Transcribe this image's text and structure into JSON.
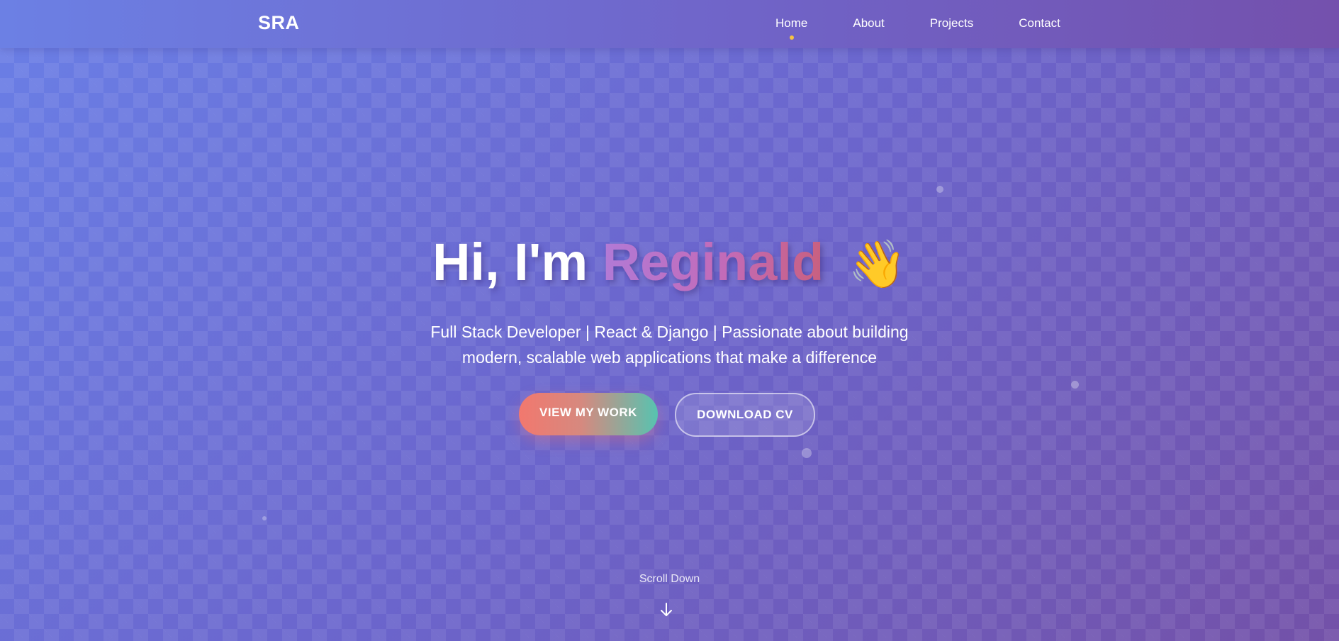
{
  "nav": {
    "brand": "SRA",
    "items": [
      {
        "label": "Home",
        "active": true
      },
      {
        "label": "About",
        "active": false
      },
      {
        "label": "Projects",
        "active": false
      },
      {
        "label": "Contact",
        "active": false
      }
    ],
    "active_indicator_color": "#f6c343"
  },
  "hero": {
    "greeting": "Hi, I'm",
    "name": "Reginald",
    "wave_emoji": "👋",
    "subtitle_line1": "Full Stack Developer | React & Django | Passionate about building",
    "subtitle_line2": "modern, scalable web applications that make a difference",
    "primary_button": "VIEW MY WORK",
    "secondary_button": "DOWNLOAD CV"
  },
  "scroll": {
    "label": "Scroll Down",
    "icon": "arrow-down-icon"
  },
  "colors": {
    "background_start": "#6a7fe6",
    "background_end": "#7351a8",
    "name_gradient_start": "#b27ad6",
    "name_gradient_end": "#c8607f",
    "primary_button_start": "#f2786e",
    "primary_button_end": "#57c3b0"
  }
}
